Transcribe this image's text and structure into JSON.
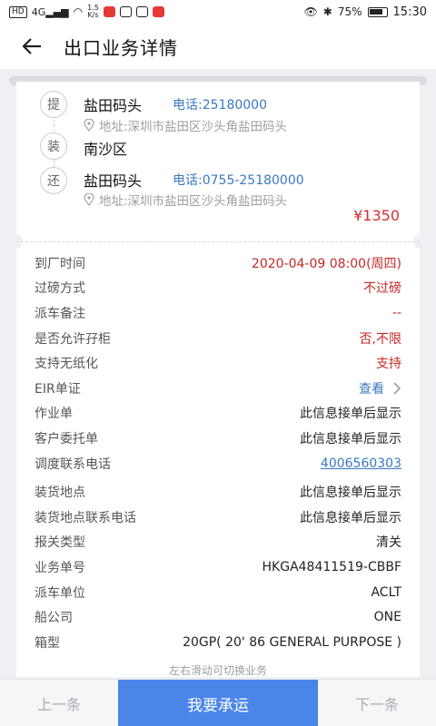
{
  "status_bar": {
    "hd": "HD",
    "signal": "4G",
    "speed_value": "1.5",
    "speed_unit": "K/s",
    "battery": "75%",
    "time": "15:30"
  },
  "header": {
    "title": "出口业务详情"
  },
  "route": {
    "stops": [
      {
        "badge": "提",
        "name": "盐田码头",
        "phone": "电话:25180000",
        "address": "地址:深圳市盐田区沙头角盐田码头"
      },
      {
        "badge": "装",
        "name": "南沙区"
      },
      {
        "badge": "还",
        "name": "盐田码头",
        "phone": "电话:0755-25180000",
        "address": "地址:深圳市盐田区沙头角盐田码头"
      }
    ],
    "price": "¥1350"
  },
  "details": [
    {
      "label": "到厂时间",
      "value": "2020-04-09 08:00(周四)",
      "style": "red"
    },
    {
      "label": "过磅方式",
      "value": "不过磅",
      "style": "red"
    },
    {
      "label": "派车备注",
      "value": "--",
      "style": "red"
    },
    {
      "label": "是否允许孖柜",
      "value": "否,不限",
      "style": "red"
    },
    {
      "label": "支持无纸化",
      "value": "支持",
      "style": "red"
    },
    {
      "label": "EIR单证",
      "value": "查看",
      "style": "blue"
    },
    {
      "label": "作业单",
      "value": "此信息接单后显示",
      "style": ""
    },
    {
      "label": "客户委托单",
      "value": "此信息接单后显示",
      "style": ""
    },
    {
      "label": "调度联系电话",
      "value": "4006560303",
      "style": "link"
    },
    {
      "label": "装货地点",
      "value": "此信息接单后显示",
      "style": ""
    },
    {
      "label": "装货地点联系电话",
      "value": "此信息接单后显示",
      "style": ""
    },
    {
      "label": "报关类型",
      "value": "清关",
      "style": ""
    },
    {
      "label": "业务单号",
      "value": "HKGA48411519-CBBF",
      "style": ""
    },
    {
      "label": "派车单位",
      "value": "ACLT",
      "style": ""
    },
    {
      "label": "船公司",
      "value": "ONE",
      "style": ""
    },
    {
      "label": "箱型",
      "value": "20GP( 20' 86 GENERAL PURPOSE )",
      "style": ""
    }
  ],
  "swipe_hint": "左右滑动可切换业务",
  "bottom_bar": {
    "prev": "上一条",
    "accept": "我要承运",
    "next": "下一条"
  },
  "colors": {
    "accent": "#4a86e8",
    "price": "#d32f2f",
    "link": "#3a78c2"
  }
}
